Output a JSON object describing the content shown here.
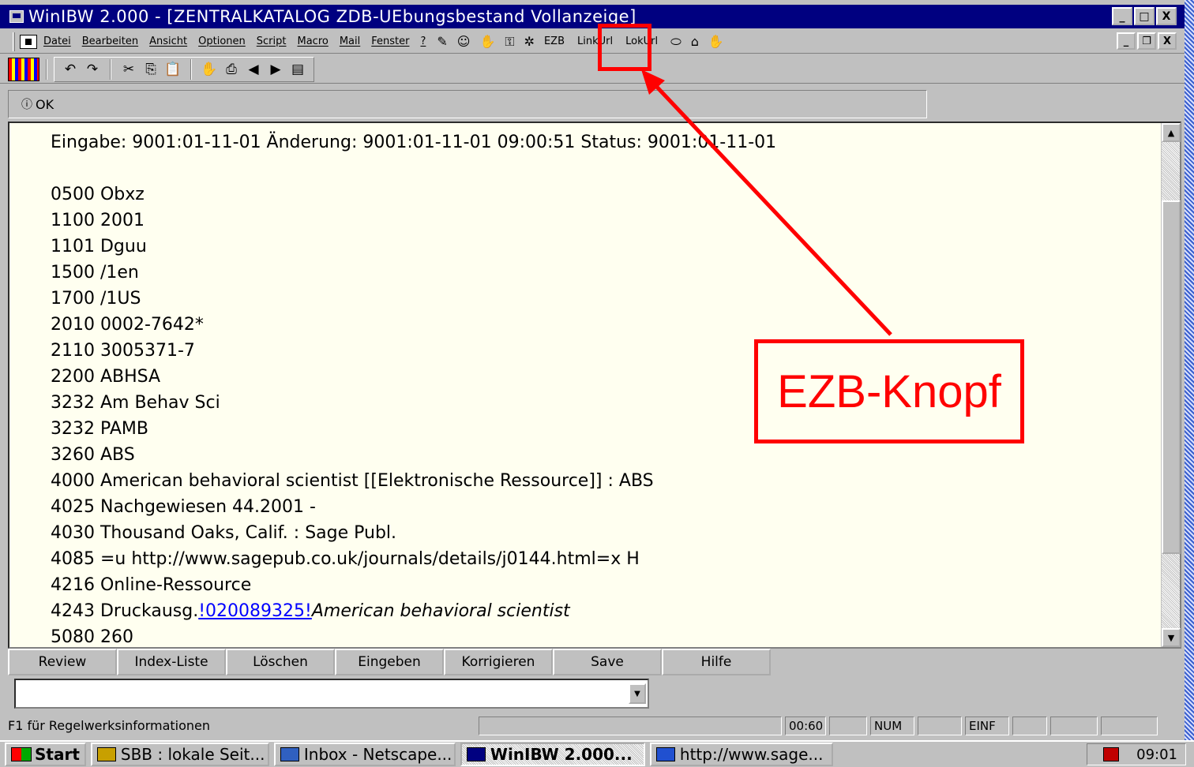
{
  "window": {
    "title": "WinIBW 2.000 - [ZENTRALKATALOG ZDB-UEbungsbestand Vollanzeige]",
    "buttons": {
      "minimize": "_",
      "maximize": "□",
      "close": "X"
    }
  },
  "menubar": {
    "items": [
      "Datei",
      "Bearbeiten",
      "Ansicht",
      "Optionen",
      "Script",
      "Macro",
      "Mail",
      "Fenster",
      "?"
    ],
    "tool_glyphs": [
      "✎",
      "☺",
      "✋",
      "⚿",
      "✲"
    ],
    "buttons": [
      "EZB",
      "LinkUrl",
      "LokUrl"
    ],
    "tail_glyphs": [
      "⬭",
      "⌂",
      "✋"
    ],
    "mdi_buttons": {
      "minimize": "_",
      "restore": "❐",
      "close": "X"
    }
  },
  "toolbar": {
    "icons": [
      "↶",
      "↷",
      "✂",
      "⎘",
      "📋",
      "✋",
      "⎙",
      "◀",
      "▶",
      "▤"
    ]
  },
  "message": {
    "icon": "ⓘ",
    "text": "OK"
  },
  "record": {
    "lines": [
      "Eingabe: 9001:01-11-01 Änderung: 9001:01-11-01 09:00:51 Status: 9001:01-11-01",
      "",
      "0500 Obxz",
      "1100 2001",
      "1101 Dguu",
      "1500 /1en",
      "1700 /1US",
      "2010 0002-7642*",
      "2110 3005371-7",
      "2200 ABHSA",
      "3232 Am Behav Sci",
      "3232 PAMB",
      "3260 ABS",
      "4000 American behavioral scientist [[Elektronische Ressource]] : ABS",
      "4025 Nachgewiesen 44.2001 -",
      "4030 Thousand Oaks, Calif. : Sage Publ.",
      "4085 =u http://www.sagepub.co.uk/journals/details/j0144.html=x H",
      "4216 Online-Ressource"
    ],
    "link_line": {
      "prefix": "4243 Druckausg.",
      "link": "!020089325!",
      "italic": "American behavioral scientist"
    },
    "last_line": "5080 260"
  },
  "scrollbar": {
    "up": "▲",
    "down": "▼"
  },
  "function_buttons": [
    "Review",
    "Index-Liste",
    "Löschen",
    "Eingeben",
    "Korrigieren",
    "Save",
    "Hilfe"
  ],
  "command_combo": {
    "value": "",
    "arrow": "▼"
  },
  "statusbar": {
    "hint": "F1 für Regelwerksinformationen",
    "time_counter": "00:60",
    "num": "NUM",
    "insert": "EINF"
  },
  "taskbar": {
    "start": "Start",
    "tasks": [
      "SBB : lokale Seit...",
      "Inbox - Netscape...",
      "WinIBW 2.000...",
      "http://www.sage..."
    ],
    "clock": "09:01"
  },
  "annotation": {
    "label": "EZB-Knopf",
    "color": "#ff0000"
  }
}
